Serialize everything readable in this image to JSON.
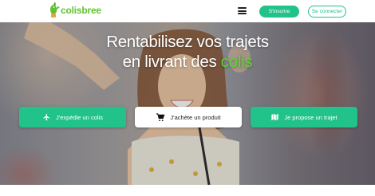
{
  "nav": {
    "logo_text": "colisbree",
    "menu_icon": "hamburger-icon",
    "signup_label": "S'inscrire",
    "login_label": "Se connecter"
  },
  "hero": {
    "headline_line1": "Rentabilisez vos trajets",
    "headline_line2_prefix": "en livrant des ",
    "headline_line2_accent": "colis"
  },
  "cta": [
    {
      "label": "J'expédie un colis",
      "icon": "plane-icon"
    },
    {
      "label": "J'achète un produit",
      "icon": "cart-icon"
    },
    {
      "label": "Je propose un trajet",
      "icon": "map-icon"
    }
  ],
  "colors": {
    "brand_green": "#22c38a",
    "logo_green": "#62c22e",
    "accent_text": "#5fd23a"
  }
}
